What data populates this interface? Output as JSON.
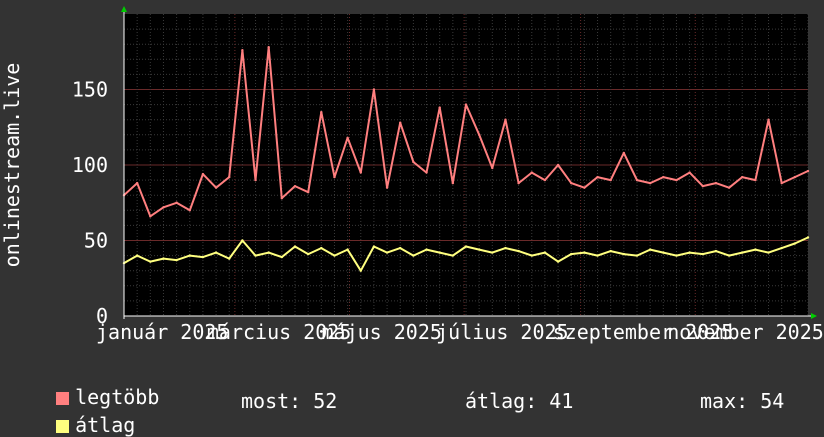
{
  "chart_data": {
    "type": "line",
    "ylabel": "onlinestream.live",
    "ylim": [
      0,
      200
    ],
    "yticks": [
      0,
      50,
      100,
      150
    ],
    "x_start": "2025-01-01",
    "x_end": "2025-12-31",
    "x_tick_labels": [
      {
        "date": "2025-01-01",
        "label": "január 2025"
      },
      {
        "date": "2025-03-01",
        "label": "március 2025"
      },
      {
        "date": "2025-05-01",
        "label": "május 2025"
      },
      {
        "date": "2025-07-01",
        "label": "július 2025"
      },
      {
        "date": "2025-09-01",
        "label": "szeptember 2025"
      },
      {
        "date": "2025-11-01",
        "label": "november 2025"
      }
    ],
    "grid": true,
    "series": [
      {
        "name": "legtöbb",
        "color": "#ff7f7f",
        "points": [
          [
            "2025-01-01",
            80
          ],
          [
            "2025-01-08",
            88
          ],
          [
            "2025-01-15",
            66
          ],
          [
            "2025-01-22",
            72
          ],
          [
            "2025-01-29",
            75
          ],
          [
            "2025-02-05",
            70
          ],
          [
            "2025-02-12",
            94
          ],
          [
            "2025-02-19",
            85
          ],
          [
            "2025-02-26",
            92
          ],
          [
            "2025-03-05",
            176
          ],
          [
            "2025-03-12",
            90
          ],
          [
            "2025-03-19",
            178
          ],
          [
            "2025-03-26",
            78
          ],
          [
            "2025-04-02",
            86
          ],
          [
            "2025-04-09",
            82
          ],
          [
            "2025-04-16",
            135
          ],
          [
            "2025-04-23",
            92
          ],
          [
            "2025-04-30",
            118
          ],
          [
            "2025-05-07",
            95
          ],
          [
            "2025-05-14",
            150
          ],
          [
            "2025-05-21",
            85
          ],
          [
            "2025-05-28",
            128
          ],
          [
            "2025-06-04",
            102
          ],
          [
            "2025-06-11",
            95
          ],
          [
            "2025-06-18",
            138
          ],
          [
            "2025-06-25",
            88
          ],
          [
            "2025-07-02",
            140
          ],
          [
            "2025-07-09",
            120
          ],
          [
            "2025-07-16",
            98
          ],
          [
            "2025-07-23",
            130
          ],
          [
            "2025-07-30",
            88
          ],
          [
            "2025-08-06",
            95
          ],
          [
            "2025-08-13",
            90
          ],
          [
            "2025-08-20",
            100
          ],
          [
            "2025-08-27",
            88
          ],
          [
            "2025-09-03",
            85
          ],
          [
            "2025-09-10",
            92
          ],
          [
            "2025-09-17",
            90
          ],
          [
            "2025-09-24",
            108
          ],
          [
            "2025-10-01",
            90
          ],
          [
            "2025-10-08",
            88
          ],
          [
            "2025-10-15",
            92
          ],
          [
            "2025-10-22",
            90
          ],
          [
            "2025-10-29",
            95
          ],
          [
            "2025-11-05",
            86
          ],
          [
            "2025-11-12",
            88
          ],
          [
            "2025-11-19",
            85
          ],
          [
            "2025-11-26",
            92
          ],
          [
            "2025-12-03",
            90
          ],
          [
            "2025-12-10",
            130
          ],
          [
            "2025-12-17",
            88
          ],
          [
            "2025-12-24",
            92
          ],
          [
            "2025-12-31",
            96
          ]
        ]
      },
      {
        "name": "átlag",
        "color": "#ffff7f",
        "points": [
          [
            "2025-01-01",
            35
          ],
          [
            "2025-01-08",
            40
          ],
          [
            "2025-01-15",
            36
          ],
          [
            "2025-01-22",
            38
          ],
          [
            "2025-01-29",
            37
          ],
          [
            "2025-02-05",
            40
          ],
          [
            "2025-02-12",
            39
          ],
          [
            "2025-02-19",
            42
          ],
          [
            "2025-02-26",
            38
          ],
          [
            "2025-03-05",
            50
          ],
          [
            "2025-03-12",
            40
          ],
          [
            "2025-03-19",
            42
          ],
          [
            "2025-03-26",
            39
          ],
          [
            "2025-04-02",
            46
          ],
          [
            "2025-04-09",
            41
          ],
          [
            "2025-04-16",
            45
          ],
          [
            "2025-04-23",
            40
          ],
          [
            "2025-04-30",
            44
          ],
          [
            "2025-05-07",
            30
          ],
          [
            "2025-05-14",
            46
          ],
          [
            "2025-05-21",
            42
          ],
          [
            "2025-05-28",
            45
          ],
          [
            "2025-06-04",
            40
          ],
          [
            "2025-06-11",
            44
          ],
          [
            "2025-06-18",
            42
          ],
          [
            "2025-06-25",
            40
          ],
          [
            "2025-07-02",
            46
          ],
          [
            "2025-07-09",
            44
          ],
          [
            "2025-07-16",
            42
          ],
          [
            "2025-07-23",
            45
          ],
          [
            "2025-07-30",
            43
          ],
          [
            "2025-08-06",
            40
          ],
          [
            "2025-08-13",
            42
          ],
          [
            "2025-08-20",
            36
          ],
          [
            "2025-08-27",
            41
          ],
          [
            "2025-09-03",
            42
          ],
          [
            "2025-09-10",
            40
          ],
          [
            "2025-09-17",
            43
          ],
          [
            "2025-09-24",
            41
          ],
          [
            "2025-10-01",
            40
          ],
          [
            "2025-10-08",
            44
          ],
          [
            "2025-10-15",
            42
          ],
          [
            "2025-10-22",
            40
          ],
          [
            "2025-10-29",
            42
          ],
          [
            "2025-11-05",
            41
          ],
          [
            "2025-11-12",
            43
          ],
          [
            "2025-11-19",
            40
          ],
          [
            "2025-11-26",
            42
          ],
          [
            "2025-12-03",
            44
          ],
          [
            "2025-12-10",
            42
          ],
          [
            "2025-12-17",
            45
          ],
          [
            "2025-12-24",
            48
          ],
          [
            "2025-12-31",
            52
          ]
        ]
      }
    ]
  },
  "legend": {
    "items": [
      {
        "label": "legtöbb",
        "color": "#ff7f7f"
      },
      {
        "label": "átlag",
        "color": "#ffff7f"
      }
    ]
  },
  "stats": {
    "now_text": "most: 52",
    "avg_text": "átlag: 41",
    "max_text": "max: 54"
  }
}
